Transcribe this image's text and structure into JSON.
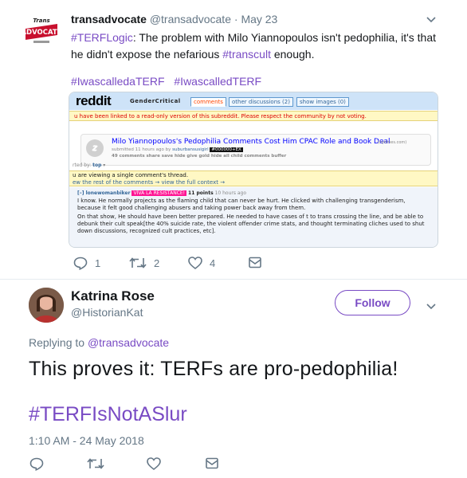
{
  "quoted_tweet": {
    "author_name": "transadvocate",
    "author_handle": "@transadvocate",
    "separator": "·",
    "date": "May 23",
    "avatar_lettering": "TransAdvocate",
    "body_hash1": "#TERFLogic",
    "body_text": ": The problem with Milo Yiannopoulos isn't pedophilia, it's that he didn't expose the nefarious ",
    "body_hash2": "#transcult",
    "body_tail": " enough.",
    "tags": [
      "#IwascalledaTERF",
      "#IwascalledTERF"
    ],
    "counts": {
      "reply": "1",
      "retweet": "2",
      "like": "4"
    }
  },
  "reddit_screenshot": {
    "logo": "reddit",
    "subreddit": "GenderCritical",
    "tabs": [
      "comments",
      "other discussions (2)",
      "show images (0)"
    ],
    "notice": "u have been linked to a read-only version of this subreddit. Please respect the community by not voting.",
    "post_title": "Milo Yiannopoulos's Pedophilia Comments Cost Him CPAC Role and Book Deal",
    "post_domain": "(nytimes.com)",
    "submitted_prefix": "submitted 11 hours ago by",
    "submitter": "suburbansusigirl",
    "flair": "#000000+EX",
    "post_links": "49 comments   share   save   hide   give gold   hide all child comments   buffer",
    "sorted_by": "rted by:",
    "sorted_value": "top",
    "single_thread_line1": "u are viewing a single comment's thread.",
    "single_thread_line2": "ew the rest of the comments → view the full context →",
    "comment_user": "[–] lonewomanbiker",
    "comment_flair": "VIVA LA RESISTANCE!",
    "comment_points": "11 points",
    "comment_age": "10 hours ago",
    "comment_p1": "I know. He normally projects as the flaming child that can never be hurt. He clicked with challenging transgenderism, because it felt good challenging abusers and taking power back away from them.",
    "comment_p2": "On that show, He should have been better prepared. He needed to have cases of t to trans crossing the line, and be able to debunk their cult speak[the 40% suicide rate, the violent offender crime stats, and thought terminating cliches used to shut down discussions, recognized cult practices, etc]."
  },
  "main_tweet": {
    "author_name": "Katrina Rose",
    "author_handle": "@HistorianKat",
    "follow_label": "Follow",
    "replying_prefix": "Replying to",
    "replying_to": "@transadvocate",
    "text": "This proves it: TERFs are pro-pedophilia!",
    "hashtag": "#TERFIsNotASlur",
    "timestamp": "1:10 AM - 24 May 2018"
  },
  "icons": [
    "reply-icon",
    "retweet-icon",
    "like-icon",
    "message-icon",
    "chevron-down-icon"
  ],
  "colors": {
    "accent": "#794bc4",
    "secondary_text": "#657786",
    "reddit_header": "#cee3f8"
  }
}
